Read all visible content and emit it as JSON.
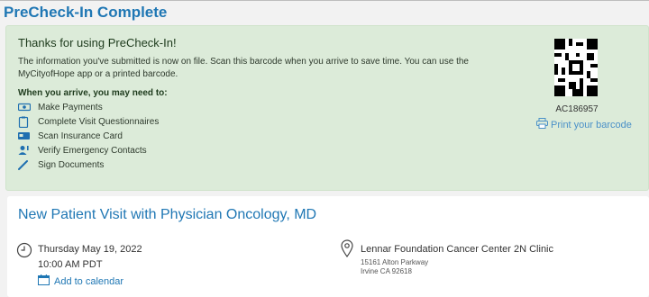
{
  "page_title": "PreCheck-In Complete",
  "notice": {
    "title": "Thanks for using PreCheck-In!",
    "message": "The information you've submitted is now on file. Scan this barcode when you arrive to save time. You can use the MyCityofHope app or a printed barcode.",
    "arrive_heading": "When you arrive, you may need to:",
    "tasks": [
      {
        "label": "Make Payments",
        "icon": "payment-icon"
      },
      {
        "label": "Complete Visit Questionnaires",
        "icon": "questionnaire-icon"
      },
      {
        "label": "Scan Insurance Card",
        "icon": "insurance-card-icon"
      },
      {
        "label": "Verify Emergency Contacts",
        "icon": "contacts-icon"
      },
      {
        "label": "Sign Documents",
        "icon": "pen-icon"
      }
    ],
    "barcode_code": "AC186957",
    "print_label": "Print your barcode"
  },
  "visit": {
    "title": "New Patient Visit with Physician Oncology, MD",
    "date": "Thursday May 19, 2022",
    "time": "10:00 AM PDT",
    "calendar_label": "Add to calendar",
    "location_name": "Lennar Foundation Cancer Center 2N Clinic",
    "address_line1": "15161 Alton Parkway",
    "address_line2": "Irvine CA 92618"
  },
  "colors": {
    "accent": "#1f77b4",
    "success_bg": "#dcebd9",
    "link": "#4a90c8"
  }
}
